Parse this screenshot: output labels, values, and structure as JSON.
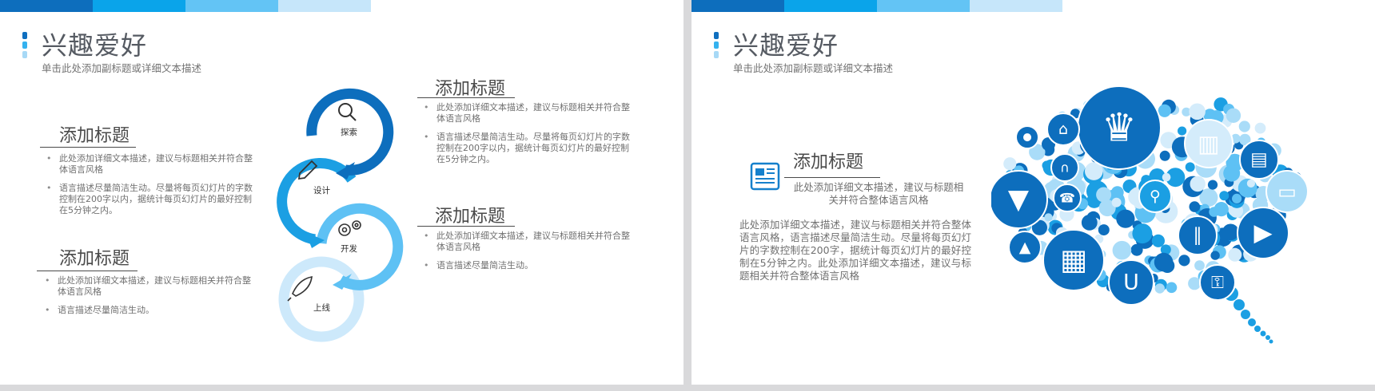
{
  "colors": {
    "bar": [
      "#0d6ebd",
      "#0aa4ea",
      "#63c4f5",
      "#c6e6fa"
    ],
    "ring": [
      "#0d6ebd",
      "#1b9fe3",
      "#5ec1f4",
      "#cde9fb"
    ],
    "accent": "#1580cc"
  },
  "left": {
    "title": "兴趣爱好",
    "subtitle": "单击此处添加副标题或详细文本描述",
    "blocks": [
      {
        "title": "添加标题",
        "bullets": [
          "此处添加详细文本描述，建议与标题相关并符合整体语言风格",
          "语言描述尽量简洁生动。尽量将每页幻灯片的字数控制在200字以内，据统计每页幻灯片的最好控制在5分钟之内。"
        ]
      },
      {
        "title": "添加标题",
        "bullets": [
          "此处添加详细文本描述，建议与标题相关并符合整体语言风格",
          "语言描述尽量简洁生动。"
        ]
      },
      {
        "title": "添加标题",
        "bullets": [
          "此处添加详细文本描述，建议与标题相关并符合整体语言风格",
          "语言描述尽量简洁生动。尽量将每页幻灯片的字数控制在200字以内，据统计每页幻灯片的最好控制在5分钟之内。"
        ]
      },
      {
        "title": "添加标题",
        "bullets": [
          "此处添加详细文本描述，建议与标题相关并符合整体语言风格",
          "语言描述尽量简洁生动。"
        ]
      }
    ],
    "steps": [
      {
        "label": "探索",
        "icon": "magnifier-icon"
      },
      {
        "label": "设计",
        "icon": "pencil-icon"
      },
      {
        "label": "开发",
        "icon": "gears-icon"
      },
      {
        "label": "上线",
        "icon": "rocket-icon"
      }
    ]
  },
  "right": {
    "title": "兴趣爱好",
    "subtitle": "单击此处添加副标题或详细文本描述",
    "heading": "添加标题",
    "heading_desc": "此处添加详细文本描述，建议与标题相关并符合整体语言风格",
    "paragraph": "此处添加详细文本描述，建议与标题相关并符合整体语言风格，语言描述尽量简洁生动。尽量将每页幻灯片的字数控制在200字，据统计每页幻灯片的最好控制在5分钟之内。此处添加详细文本描述，建议与标题相关并符合整体语言风格",
    "icons": [
      "crown-icon",
      "apple-icon",
      "tag-icon",
      "magnet-icon",
      "trash-icon",
      "wallet-icon",
      "tie-icon",
      "phone-icon",
      "broom-icon",
      "inbox-icon",
      "paperclip-icon",
      "campfire-icon",
      "calculator-icon",
      "video-icon",
      "cup-icon",
      "lock-icon",
      "newspaper-icon"
    ]
  }
}
